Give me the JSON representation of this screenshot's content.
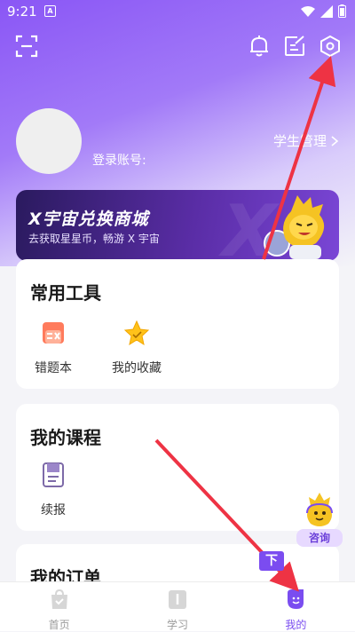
{
  "status_bar": {
    "time": "9:21",
    "notif_letter": "A"
  },
  "profile": {
    "account_label": "登录账号:",
    "student_mgmt": "学生管理"
  },
  "banner": {
    "title": "X宇宙兑换商城",
    "subtitle": "去获取星星币，畅游 X 宇宙",
    "bg_letter": "X"
  },
  "tools": {
    "title": "常用工具",
    "items": [
      {
        "label": "错题本",
        "icon": "wrong-book-icon"
      },
      {
        "label": "我的收藏",
        "icon": "star-icon"
      }
    ]
  },
  "courses": {
    "title": "我的课程",
    "items": [
      {
        "label": "续报",
        "icon": "book-icon"
      }
    ]
  },
  "orders": {
    "title": "我的订单"
  },
  "consult": {
    "label": "咨询"
  },
  "annotation": {
    "label": "下"
  },
  "tabbar": {
    "items": [
      {
        "label": "首页",
        "icon": "home-bag-icon"
      },
      {
        "label": "学习",
        "icon": "study-book-icon"
      },
      {
        "label": "我的",
        "icon": "me-face-icon",
        "active": true
      }
    ]
  },
  "colors": {
    "accent": "#7a4df0",
    "annotation_arrow": "#ee3344"
  }
}
